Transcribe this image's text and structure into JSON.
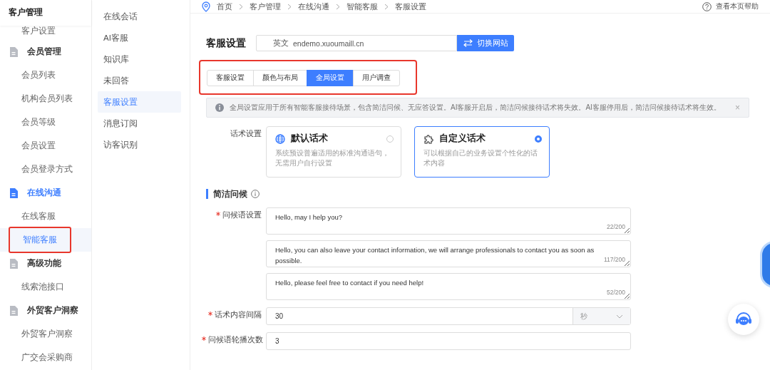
{
  "sidebar": {
    "title": "客户管理",
    "items": [
      {
        "kind": "item",
        "label": "客户设置",
        "selected": false,
        "highlighted": false
      },
      {
        "kind": "group",
        "label": "会员管理",
        "selected": false
      },
      {
        "kind": "item",
        "label": "会员列表",
        "selected": false,
        "highlighted": false
      },
      {
        "kind": "item",
        "label": "机构会员列表",
        "selected": false,
        "highlighted": false
      },
      {
        "kind": "item",
        "label": "会员等级",
        "selected": false,
        "highlighted": false
      },
      {
        "kind": "item",
        "label": "会员设置",
        "selected": false,
        "highlighted": false
      },
      {
        "kind": "item",
        "label": "会员登录方式",
        "selected": false,
        "highlighted": false
      },
      {
        "kind": "group",
        "label": "在线沟通",
        "selected": true
      },
      {
        "kind": "item",
        "label": "在线客服",
        "selected": false,
        "highlighted": false
      },
      {
        "kind": "item",
        "label": "智能客服",
        "selected": true,
        "highlighted": true
      },
      {
        "kind": "group",
        "label": "高级功能",
        "selected": false
      },
      {
        "kind": "item",
        "label": "线索池接口",
        "selected": false,
        "highlighted": false
      },
      {
        "kind": "group",
        "label": "外贸客户洞察",
        "selected": false
      },
      {
        "kind": "item",
        "label": "外贸客户洞察",
        "selected": false,
        "highlighted": false
      },
      {
        "kind": "item",
        "label": "广交会采购商",
        "selected": false,
        "highlighted": false
      }
    ]
  },
  "submenu": [
    {
      "label": "在线会话",
      "selected": false
    },
    {
      "label": "AI客服",
      "selected": false
    },
    {
      "label": "知识库",
      "selected": false
    },
    {
      "label": "未回答",
      "selected": false
    },
    {
      "label": "客服设置",
      "selected": true
    },
    {
      "label": "消息订阅",
      "selected": false
    },
    {
      "label": "访客识别",
      "selected": false
    }
  ],
  "breadcrumb": [
    "首页",
    "客户管理",
    "在线沟通",
    "智能客服",
    "客服设置"
  ],
  "help_link": "查看本页帮助",
  "page_title": "客服设置",
  "site": {
    "language": "英文",
    "domain": "endemo.xuoumaill.cn",
    "button": "切换网站"
  },
  "tabs": {
    "highlighted": true,
    "items": [
      {
        "label": "客服设置",
        "selected": false
      },
      {
        "label": "颜色与布局",
        "selected": false
      },
      {
        "label": "全局设置",
        "selected": true
      },
      {
        "label": "用户调查",
        "selected": false
      }
    ]
  },
  "alert": {
    "text": "全局设置应用于所有智能客服接待场景，包含简洁问候、无应答设置。AI客服开启后，简洁问候接待话术将失效。AI客服停用后，简洁问候接待话术将生效。",
    "close": "×"
  },
  "script_setting": {
    "label": "话术设置",
    "options": [
      {
        "kind": "globe",
        "title": "默认话术",
        "description": "系统预设普遍适用的标准沟通语句，无需用户自行设置",
        "selected": false
      },
      {
        "kind": "puzzle",
        "title": "自定义话术",
        "description": "可以根据自己的业务设置个性化的话术内容",
        "selected": true
      }
    ]
  },
  "section": {
    "title": "简洁问候"
  },
  "greetings": {
    "label": "问候语设置",
    "required": true,
    "entries": [
      {
        "value": "Hello, may I help you?",
        "count": "22/200"
      },
      {
        "value": "Hello, you can also leave your contact information, we will arrange professionals to contact you as soon as possible.",
        "count": "117/200"
      },
      {
        "value": "Hello, please feel free to contact if you need help!",
        "count": "52/200"
      }
    ]
  },
  "interval": {
    "label": "话术内容间隔",
    "required": true,
    "value": "30",
    "unit": "秒"
  },
  "rotation": {
    "label": "问候语轮播次数",
    "required": true,
    "value": "3"
  }
}
